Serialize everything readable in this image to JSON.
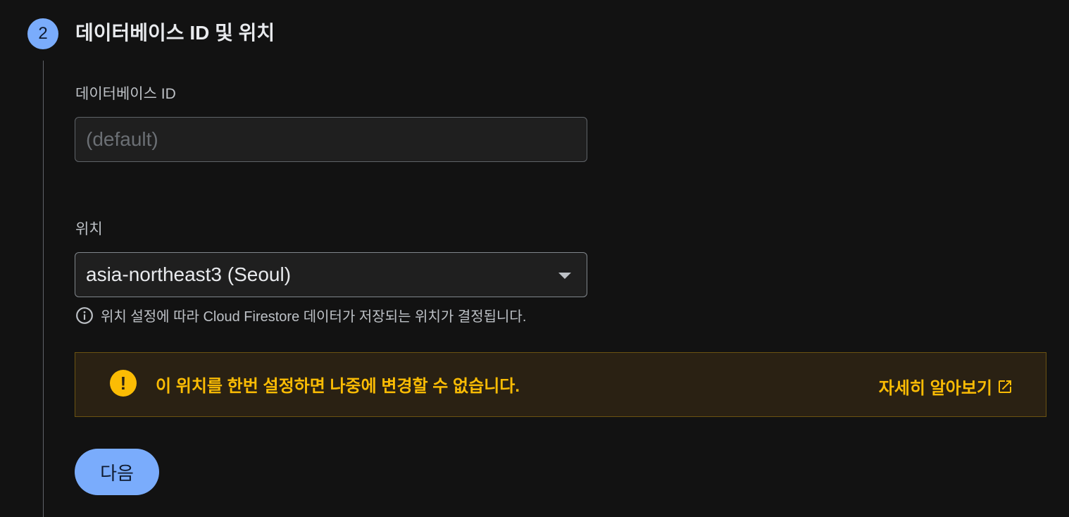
{
  "step": {
    "number": "2",
    "title": "데이터베이스 ID 및 위치"
  },
  "database_id": {
    "label": "데이터베이스 ID",
    "placeholder": "(default)",
    "value": ""
  },
  "location": {
    "label": "위치",
    "selected": "asia-northeast3 (Seoul)",
    "hint": "위치 설정에 따라 Cloud Firestore 데이터가 저장되는 위치가 결정됩니다."
  },
  "warning": {
    "message": "이 위치를 한번 설정하면 나중에 변경할 수 없습니다.",
    "link_label": "자세히 알아보기"
  },
  "actions": {
    "next_label": "다음"
  },
  "icons": {
    "info": "info-icon",
    "warning": "warning-icon",
    "external_link": "open-in-new-icon",
    "dropdown": "dropdown-arrow-icon"
  },
  "colors": {
    "accent": "#7aacfc",
    "warning": "#fbbc04",
    "background": "#121212"
  }
}
